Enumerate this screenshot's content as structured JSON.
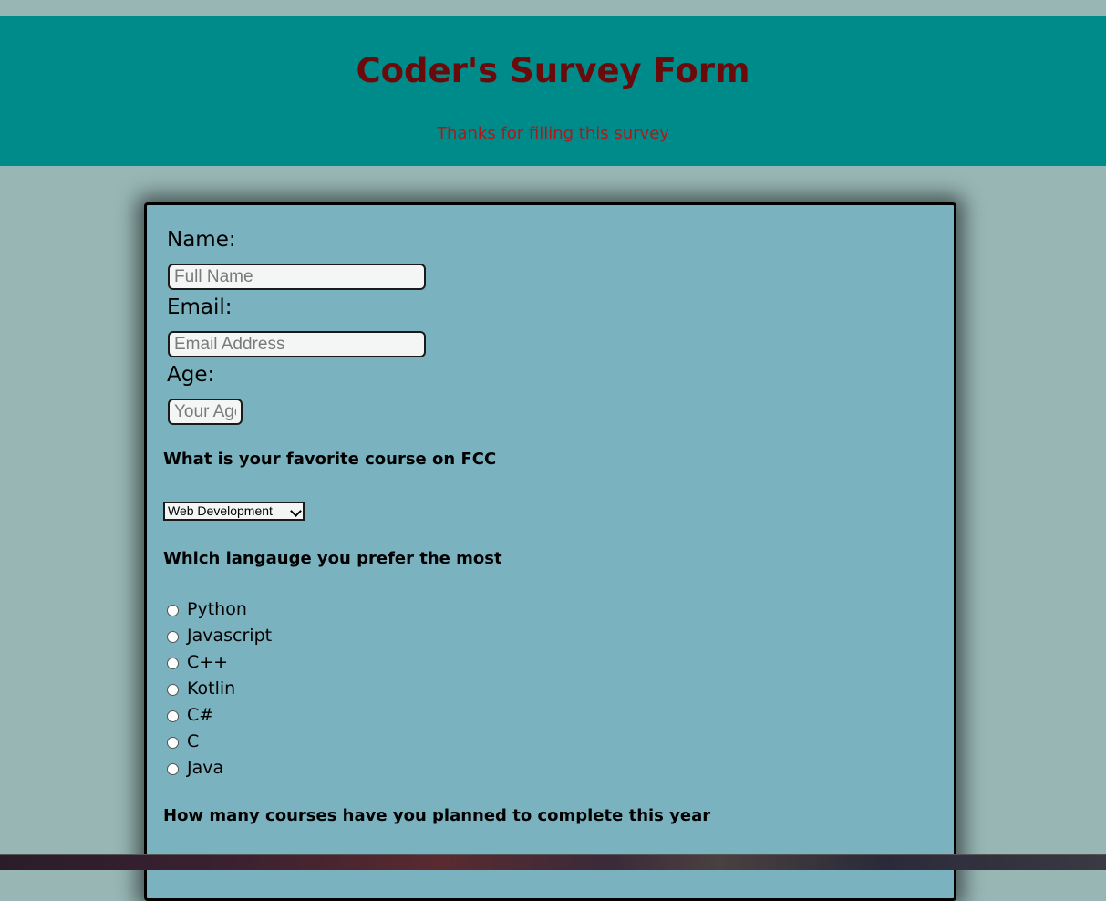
{
  "header": {
    "title": "Coder's Survey Form",
    "subtitle": "Thanks for filling this survey"
  },
  "form": {
    "name_label": "Name:",
    "name_placeholder": "Full Name",
    "email_label": "Email:",
    "email_placeholder": "Email Address",
    "age_label": "Age:",
    "age_placeholder": "Your Age",
    "course_question": "What is your favorite course on FCC",
    "course_selected": "Web Development",
    "language_question": "Which langauge you prefer the most",
    "languages": [
      "Python",
      "Javascript",
      "C++",
      "Kotlin",
      "C#",
      "C",
      "Java"
    ],
    "courses_question": "How many courses have you planned to complete this year"
  },
  "colors": {
    "page_bg": "#97b6b4",
    "header_bg": "#008b8b",
    "title": "#6b0a0a",
    "subtitle": "#b01818",
    "card_bg": "#7ab3bf"
  }
}
